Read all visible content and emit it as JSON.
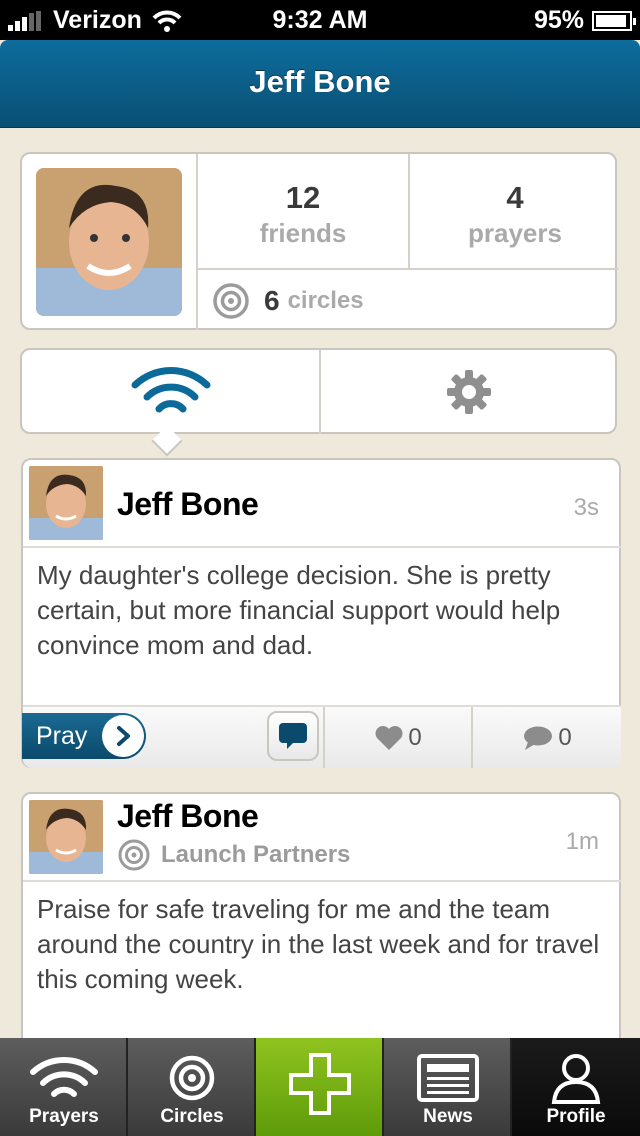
{
  "status_bar": {
    "carrier": "Verizon",
    "time": "9:32 AM",
    "battery": "95%",
    "battery_level": 0.95
  },
  "nav": {
    "title": "Jeff Bone"
  },
  "profile": {
    "friends_count": "12",
    "friends_label": "friends",
    "prayers_count": "4",
    "prayers_label": "prayers",
    "circles_count": "6",
    "circles_label": "circles"
  },
  "segment": {
    "tabs": [
      {
        "icon": "wifi-feed-icon",
        "selected": true
      },
      {
        "icon": "gear-icon",
        "selected": false
      }
    ]
  },
  "posts": [
    {
      "author": "Jeff Bone",
      "time": "3s",
      "circle": "",
      "body": "My daughter's college decision. She is pretty certain, but more financial support would help convince mom and dad.",
      "pray_label": "Pray",
      "likes": "0",
      "comments": "0"
    },
    {
      "author": "Jeff Bone",
      "time": "1m",
      "circle": "Launch Partners",
      "body": "Praise for safe traveling for me and the team around the country in the last week and for travel this coming week."
    }
  ],
  "tabbar": {
    "items": [
      {
        "label": "Prayers",
        "icon": "wifi-icon"
      },
      {
        "label": "Circles",
        "icon": "target-icon"
      },
      {
        "label": "",
        "icon": "plus-icon"
      },
      {
        "label": "News",
        "icon": "newspaper-icon"
      },
      {
        "label": "Profile",
        "icon": "person-icon"
      }
    ],
    "active": "Profile"
  },
  "colors": {
    "nav_blue": "#0b5a84",
    "background": "#efe9dc",
    "add_green": "#7db51a"
  }
}
